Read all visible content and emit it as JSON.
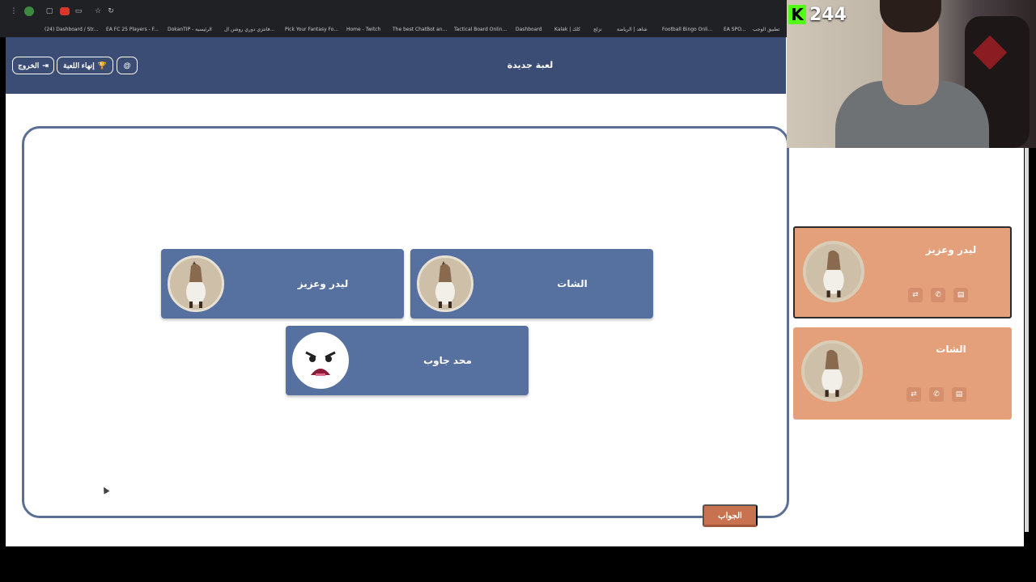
{
  "bookmarks": [
    "(24) Dashboard / Str...",
    "EA FC 25 Players - F...",
    "DokanTIP - الرئيسية",
    "فانتزي دوري روشن ال...",
    "Pick Your Fantasy Fo...",
    "Home - Twitch",
    "The best ChatBot an...",
    "Tactical Board Onlin...",
    "Dashboard",
    "Kalak | كلك",
    "نزلج",
    "شاهد | الرياضة",
    "Football Bingo Onli...",
    "EA SPO...",
    "تطبيق الوجب"
  ],
  "header": {
    "title": "لعبة جديدة",
    "exit_label": "الخروج",
    "end_game_label": "إنهاء اللعبة",
    "icon_button_glyph": "@"
  },
  "board": {
    "players": [
      {
        "name": "الشات",
        "avatar": "horse-avatar"
      },
      {
        "name": "ليدر وعزيز",
        "avatar": "horse-avatar"
      },
      {
        "name": "محد جاوب",
        "avatar": "sad-face-avatar"
      }
    ],
    "answer_label": "الجواب"
  },
  "side_panel": {
    "teams": [
      {
        "name": "ليدر وعزيز",
        "active": true
      },
      {
        "name": "الشات",
        "active": false
      }
    ]
  },
  "stream": {
    "viewer_count": "244",
    "platform_logo": "K"
  },
  "colors": {
    "header_bg": "#3b4d75",
    "player_card": "#5670a0",
    "team_card": "#e3a07b",
    "answer_button": "#c8724f",
    "kick_green": "#53fc18"
  }
}
